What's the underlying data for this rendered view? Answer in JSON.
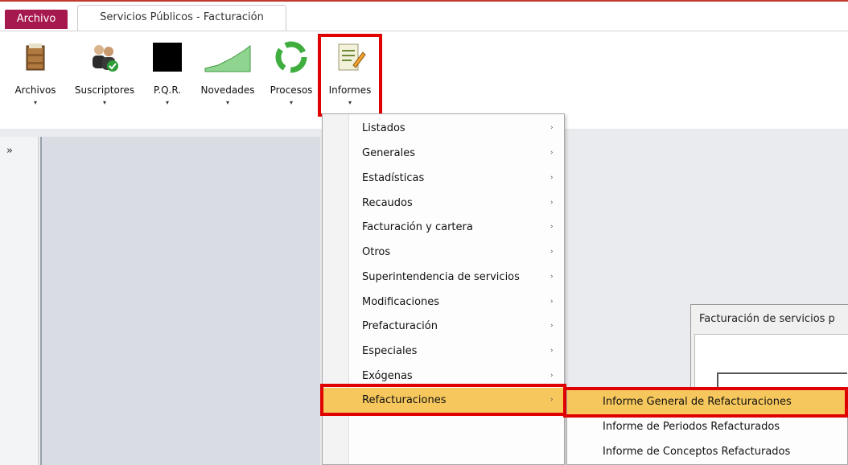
{
  "tabs": {
    "archivo": "Archivo",
    "document": "Servicios Públicos - Facturación"
  },
  "ribbon": {
    "buttons": [
      {
        "label": "Archivos",
        "icon": "cabinet-icon"
      },
      {
        "label": "Suscriptores",
        "icon": "users-icon"
      },
      {
        "label": "P.Q.R.",
        "icon": "black-square-icon"
      },
      {
        "label": "Novedades",
        "icon": "chart-area-icon"
      },
      {
        "label": "Procesos",
        "icon": "recycle-icon"
      },
      {
        "label": "Informes",
        "icon": "report-edit-icon"
      }
    ],
    "arrow": "▾"
  },
  "nav": {
    "toggle": "»"
  },
  "menu": {
    "items": [
      "Listados",
      "Generales",
      "Estadísticas",
      "Recaudos",
      "Facturación y cartera",
      "Otros",
      "Superintendencia de servicios",
      "Modificaciones",
      "Prefacturación",
      "Especiales",
      "Exógenas",
      "Refacturaciones"
    ],
    "arrow": "›"
  },
  "submenu": {
    "items": [
      "Informe General de Refacturaciones",
      "Informe de Periodos Refacturados",
      "Informe de Conceptos Refacturados"
    ]
  },
  "dialog": {
    "title": "Facturación de servicios p"
  },
  "colors": {
    "archivo_tab": "#a6194f",
    "highlight_red": "#e00000",
    "menu_selected": "#f6c75c"
  }
}
